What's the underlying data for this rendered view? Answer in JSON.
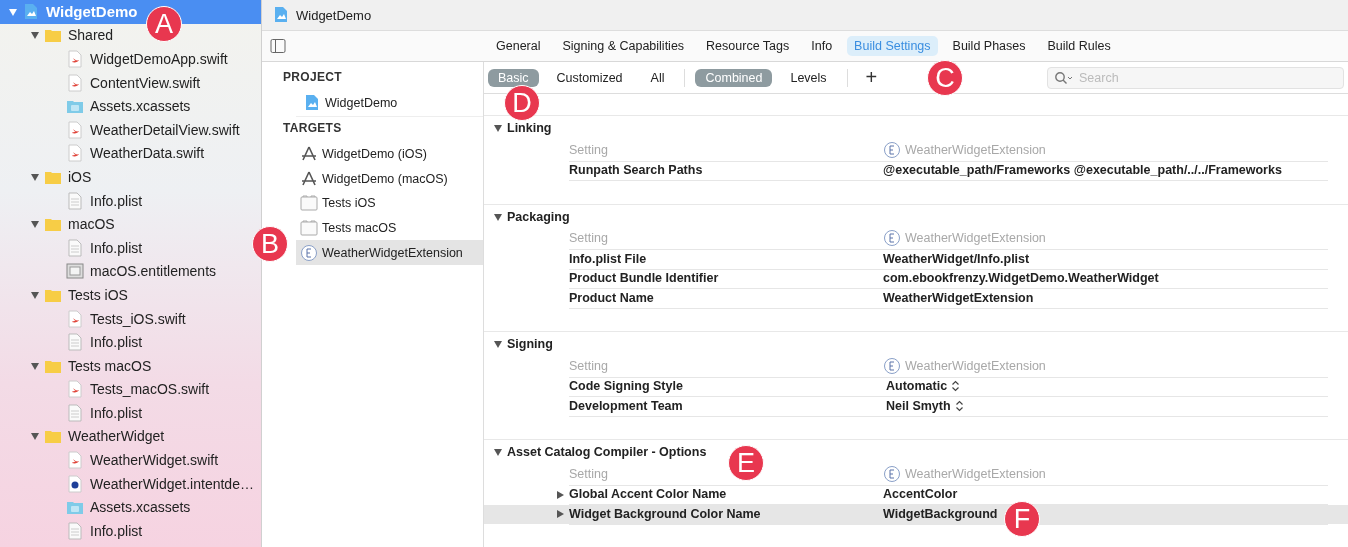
{
  "navigator": {
    "items": [
      {
        "label": "WidgetDemo",
        "kind": "project",
        "expanded": true,
        "selected": true,
        "children": [
          {
            "label": "Shared",
            "kind": "folder",
            "expanded": true,
            "selected": false,
            "children": [
              {
                "label": "WidgetDemoApp.swift",
                "kind": "swift",
                "selected": false
              },
              {
                "label": "ContentView.swift",
                "kind": "swift",
                "selected": false
              },
              {
                "label": "Assets.xcassets",
                "kind": "assets",
                "selected": false
              },
              {
                "label": "WeatherDetailView.swift",
                "kind": "swift",
                "selected": false
              },
              {
                "label": "WeatherData.swift",
                "kind": "swift",
                "selected": false
              }
            ]
          },
          {
            "label": "iOS",
            "kind": "folder",
            "expanded": true,
            "selected": false,
            "children": [
              {
                "label": "Info.plist",
                "kind": "plist",
                "selected": false
              }
            ]
          },
          {
            "label": "macOS",
            "kind": "folder",
            "expanded": true,
            "selected": false,
            "children": [
              {
                "label": "Info.plist",
                "kind": "plist",
                "selected": false
              },
              {
                "label": "macOS.entitlements",
                "kind": "entitlements",
                "selected": false
              }
            ]
          },
          {
            "label": "Tests iOS",
            "kind": "folder",
            "expanded": true,
            "selected": false,
            "children": [
              {
                "label": "Tests_iOS.swift",
                "kind": "swift",
                "selected": false
              },
              {
                "label": "Info.plist",
                "kind": "plist",
                "selected": false
              }
            ]
          },
          {
            "label": "Tests macOS",
            "kind": "folder",
            "expanded": true,
            "selected": false,
            "children": [
              {
                "label": "Tests_macOS.swift",
                "kind": "swift",
                "selected": false
              },
              {
                "label": "Info.plist",
                "kind": "plist",
                "selected": false
              }
            ]
          },
          {
            "label": "WeatherWidget",
            "kind": "folder",
            "expanded": true,
            "selected": false,
            "children": [
              {
                "label": "WeatherWidget.swift",
                "kind": "swift",
                "selected": false
              },
              {
                "label": "WeatherWidget.intentde…",
                "kind": "intent",
                "selected": false
              },
              {
                "label": "Assets.xcassets",
                "kind": "assets",
                "selected": false
              },
              {
                "label": "Info.plist",
                "kind": "plist",
                "selected": false
              }
            ]
          }
        ]
      }
    ]
  },
  "editor": {
    "title": "WidgetDemo",
    "tabs": [
      {
        "label": "General",
        "selected": false
      },
      {
        "label": "Signing & Capabilities",
        "selected": false
      },
      {
        "label": "Resource Tags",
        "selected": false
      },
      {
        "label": "Info",
        "selected": false
      },
      {
        "label": "Build Settings",
        "selected": true
      },
      {
        "label": "Build Phases",
        "selected": false
      },
      {
        "label": "Build Rules",
        "selected": false
      }
    ],
    "targets_list": [
      {
        "kind": "heading",
        "label": "PROJECT"
      },
      {
        "kind": "project",
        "label": "WidgetDemo",
        "selected": false
      },
      {
        "kind": "heading",
        "label": "TARGETS"
      },
      {
        "kind": "app",
        "label": "WidgetDemo (iOS)",
        "selected": false
      },
      {
        "kind": "app",
        "label": "WidgetDemo (macOS)",
        "selected": false
      },
      {
        "kind": "tests",
        "label": "Tests iOS",
        "selected": false
      },
      {
        "kind": "tests",
        "label": "Tests macOS",
        "selected": false
      },
      {
        "kind": "extension",
        "label": "WeatherWidgetExtension",
        "selected": true
      }
    ],
    "filters": [
      {
        "label": "Basic",
        "selected": true
      },
      {
        "label": "Customized",
        "selected": false
      },
      {
        "label": "All",
        "selected": false
      }
    ],
    "views": [
      {
        "label": "Combined",
        "selected": true
      },
      {
        "label": "Levels",
        "selected": false
      }
    ],
    "add_button": "+",
    "search": {
      "placeholder": "Search"
    },
    "sections": [
      {
        "title": "Linking",
        "expanded": true,
        "header": {
          "setting": "Setting",
          "target": "WeatherWidgetExtension"
        },
        "rows": [
          {
            "name": "Runpath Search Paths",
            "value": "@executable_path/Frameworks @executable_path/../../Frameworks",
            "kind": "text",
            "selected": false
          }
        ]
      },
      {
        "title": "Packaging",
        "expanded": true,
        "header": {
          "setting": "Setting",
          "target": "WeatherWidgetExtension"
        },
        "rows": [
          {
            "name": "Info.plist File",
            "value": "WeatherWidget/Info.plist",
            "kind": "text",
            "selected": false
          },
          {
            "name": "Product Bundle Identifier",
            "value": "com.ebookfrenzy.WidgetDemo.WeatherWidget",
            "kind": "text",
            "selected": false
          },
          {
            "name": "Product Name",
            "value": "WeatherWidgetExtension",
            "kind": "text",
            "selected": false
          }
        ]
      },
      {
        "title": "Signing",
        "expanded": true,
        "header": {
          "setting": "Setting",
          "target": "WeatherWidgetExtension"
        },
        "rows": [
          {
            "name": "Code Signing Style",
            "value": "Automatic",
            "kind": "popup",
            "selected": false
          },
          {
            "name": "Development Team",
            "value": "Neil Smyth",
            "kind": "popup",
            "selected": false
          }
        ]
      },
      {
        "title": "Asset Catalog Compiler - Options",
        "expanded": true,
        "header": {
          "setting": "Setting",
          "target": "WeatherWidgetExtension"
        },
        "rows": [
          {
            "name": "Global Accent Color Name",
            "value": "AccentColor",
            "kind": "expandable",
            "expanded": false,
            "selected": false
          },
          {
            "name": "Widget Background Color Name",
            "value": "WidgetBackground",
            "kind": "expandable",
            "expanded": false,
            "selected": true
          }
        ]
      }
    ]
  },
  "callouts": [
    "A",
    "B",
    "C",
    "D",
    "E",
    "F"
  ]
}
